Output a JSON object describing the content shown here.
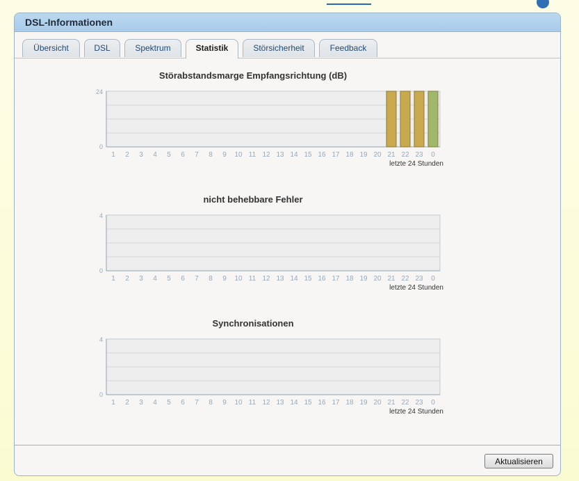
{
  "window": {
    "title": "DSL-Informationen"
  },
  "tabs": [
    {
      "label": "Übersicht",
      "active": false
    },
    {
      "label": "DSL",
      "active": false
    },
    {
      "label": "Spektrum",
      "active": false
    },
    {
      "label": "Statistik",
      "active": true
    },
    {
      "label": "Störsicherheit",
      "active": false
    },
    {
      "label": "Feedback",
      "active": false
    }
  ],
  "chart_data": [
    {
      "type": "bar",
      "title": "Störabstandsmarge Empfangsrichtung (dB)",
      "xlabel": "letzte 24 Stunden",
      "ylabel": "",
      "ylim": [
        0,
        24
      ],
      "grid": true,
      "categories": [
        "1",
        "2",
        "3",
        "4",
        "5",
        "6",
        "7",
        "8",
        "9",
        "10",
        "11",
        "12",
        "13",
        "14",
        "15",
        "16",
        "17",
        "18",
        "19",
        "20",
        "21",
        "22",
        "23",
        "0"
      ],
      "values": [
        null,
        null,
        null,
        null,
        null,
        null,
        null,
        null,
        null,
        null,
        null,
        null,
        null,
        null,
        null,
        null,
        null,
        null,
        null,
        null,
        24,
        24,
        24,
        24
      ],
      "bar_colors": [
        "#c9a94e",
        "#c9a94e",
        "#c9a94e",
        "#9fb86a"
      ]
    },
    {
      "type": "bar",
      "title": "nicht behebbare Fehler",
      "xlabel": "letzte 24 Stunden",
      "ylabel": "",
      "ylim": [
        0,
        4
      ],
      "grid": true,
      "categories": [
        "1",
        "2",
        "3",
        "4",
        "5",
        "6",
        "7",
        "8",
        "9",
        "10",
        "11",
        "12",
        "13",
        "14",
        "15",
        "16",
        "17",
        "18",
        "19",
        "20",
        "21",
        "22",
        "23",
        "0"
      ],
      "values": [
        null,
        null,
        null,
        null,
        null,
        null,
        null,
        null,
        null,
        null,
        null,
        null,
        null,
        null,
        null,
        null,
        null,
        null,
        null,
        null,
        null,
        null,
        null,
        null
      ]
    },
    {
      "type": "bar",
      "title": "Synchronisationen",
      "xlabel": "letzte 24 Stunden",
      "ylabel": "",
      "ylim": [
        0,
        4
      ],
      "grid": true,
      "categories": [
        "1",
        "2",
        "3",
        "4",
        "5",
        "6",
        "7",
        "8",
        "9",
        "10",
        "11",
        "12",
        "13",
        "14",
        "15",
        "16",
        "17",
        "18",
        "19",
        "20",
        "21",
        "22",
        "23",
        "0"
      ],
      "values": [
        null,
        null,
        null,
        null,
        null,
        null,
        null,
        null,
        null,
        null,
        null,
        null,
        null,
        null,
        null,
        null,
        null,
        null,
        null,
        null,
        null,
        null,
        null,
        null
      ]
    }
  ],
  "footer": {
    "refresh_label": "Aktualisieren"
  },
  "colors": {
    "header_bg": "#b3d1ec",
    "plot_bg": "#eeeeee",
    "grid": "#d0d4d8",
    "axis_text": "#98a8b8",
    "bar_gold": "#c9a94e",
    "bar_green": "#9fb86a"
  }
}
